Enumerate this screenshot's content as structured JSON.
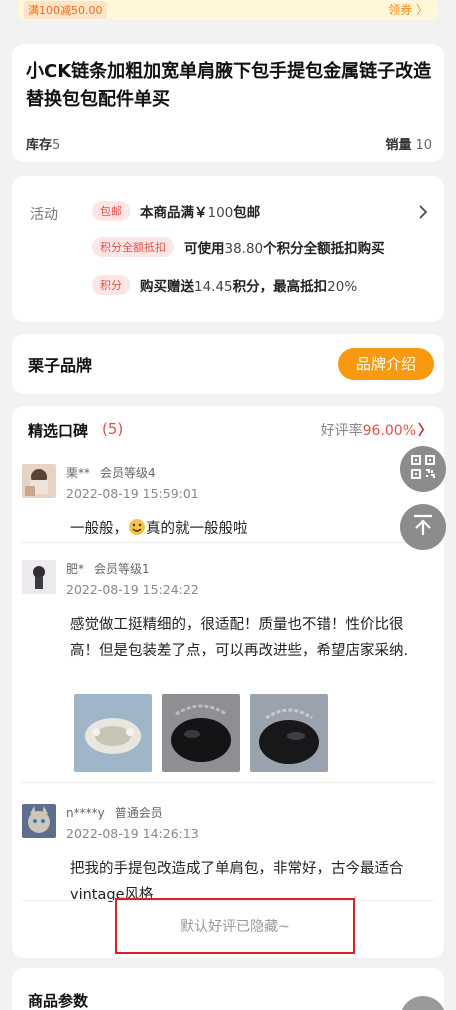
{
  "coupon": {
    "chip": "满100减50.00",
    "link": "领券 〉"
  },
  "product": {
    "title": "小CK链条加粗加宽单肩腋下包手提包金属链子改造替换包包配件单买",
    "stock_label": "库存",
    "stock_value": "5",
    "sales_label": "销量",
    "sales_value": "10"
  },
  "activity": {
    "label": "活动",
    "rows": [
      {
        "tag": "包邮",
        "text_a": "本商品满￥",
        "text_b": "100",
        "text_c": "包邮"
      },
      {
        "tag": "积分全额抵扣",
        "text_a": "可使用",
        "text_b": "38.80",
        "text_c": "个积分全额抵扣购买"
      },
      {
        "tag": "积分",
        "text_a": "购买赠送",
        "text_b": "14.45",
        "text_c": "积分，最高抵扣",
        "text_d": "20%"
      }
    ]
  },
  "brand": {
    "name": "栗子品牌",
    "button": "品牌介绍"
  },
  "reviews": {
    "title": "精选口碑",
    "count": "(5)",
    "rate_label": "好评率",
    "rate_value": "96.00%",
    "rate_arrow": "〉",
    "items": [
      {
        "user": "栗**",
        "level": "会员等级4",
        "date": "2022-08-19 15:59:01",
        "body_pre": "一般般，",
        "body_post": "真的就一般般啦"
      },
      {
        "user": "肥*",
        "level": "会员等级1",
        "date": "2022-08-19 15:24:22",
        "body": "感觉做工挺精细的，很适配！质量也不错！性价比很高！但是包装差了点，可以再改进些，希望店家采纳."
      },
      {
        "user": "n****y",
        "level": "普通会员",
        "date": "2022-08-19 14:26:13",
        "body": "把我的手提包改造成了单肩包，非常好，古今最适合vintage风格"
      }
    ],
    "hidden_note": "默认好评已隐藏~"
  },
  "params": {
    "title": "商品参数"
  },
  "colors": {
    "accent": "#e0504b",
    "brand_btn": "#f79a12",
    "highlight": "#e02020"
  },
  "icons": [
    "qrcode-icon",
    "back-to-top-icon",
    "chevron-right-icon",
    "smile-emoji-icon"
  ]
}
